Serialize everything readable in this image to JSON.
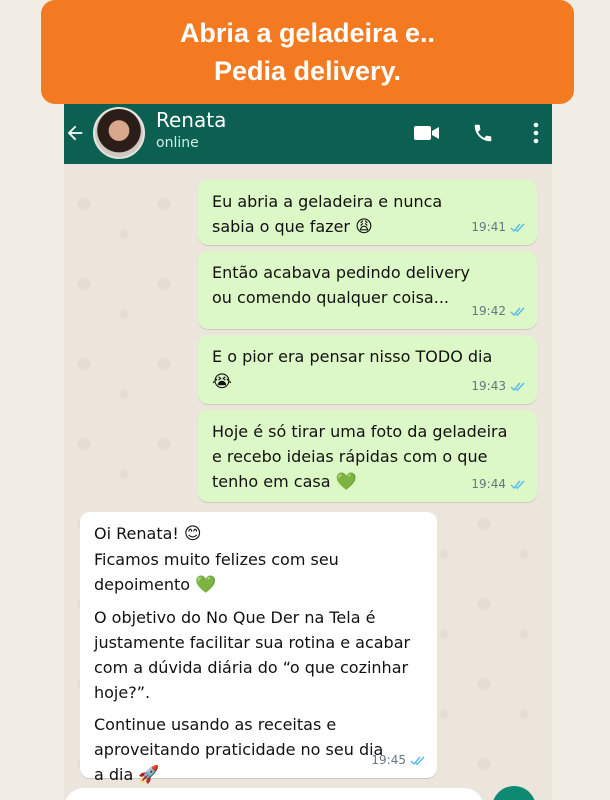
{
  "banner": {
    "line1": "Abria a geladeira e..",
    "line2": "Pedia delivery."
  },
  "header": {
    "name": "Renata",
    "status": "online",
    "icons": [
      "back-arrow-icon",
      "avatar",
      "video-call-icon",
      "phone-icon",
      "more-vert-icon"
    ]
  },
  "messages": [
    {
      "dir": "out",
      "text": "Eu abria a geladeira e nunca\nsabia o que fazer",
      "emoji": "😩",
      "time": "19:41",
      "status": "read"
    },
    {
      "dir": "out",
      "text": "Então acabava pedindo delivery\nou comendo qualquer coisa...",
      "emoji": "",
      "time": "19:42",
      "status": "read"
    },
    {
      "dir": "out",
      "text": "E o pior era pensar nisso TODO dia",
      "emoji": "😭",
      "time": "19:43",
      "status": "read"
    },
    {
      "dir": "out",
      "text": "Hoje é só tirar uma foto da geladeira\ne recebo ideias rápidas com o que\ntenho em casa",
      "emoji": "💚",
      "time": "19:44",
      "status": "read"
    },
    {
      "dir": "in",
      "p1": "Oi Renata!",
      "p1_emoji": "😊",
      "p1b": "Ficamos muito felizes com seu\ndepoimento",
      "p1b_emoji": "💚",
      "p2": "O objetivo do No Que Der na Tela é\njustamente facilitar sua rotina e acabar\ncom a dúvida diária do “o que cozinhar\nhoje?”.",
      "p3": "Continue usando as receitas e\naproveitando praticidade no seu dia\na dia",
      "p3_emoji": "🚀",
      "time": "19:45",
      "status": "read"
    }
  ],
  "colors": {
    "banner": "#f47a22",
    "header": "#0b6052",
    "outgoing": "#dcf8c6",
    "incoming": "#ffffff",
    "read_tick": "#53bdeb"
  }
}
